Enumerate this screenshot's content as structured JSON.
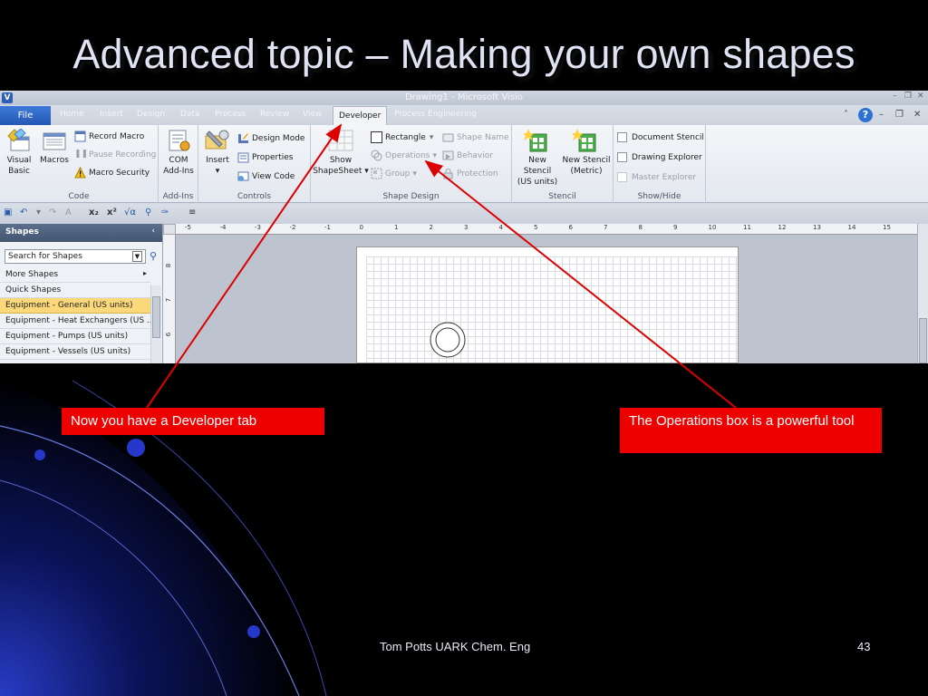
{
  "slide": {
    "title": "Advanced topic – Making your own shapes",
    "footer_author": "Tom Potts  UARK Chem. Eng",
    "page_number": "43"
  },
  "window": {
    "title": "Drawing1 - Microsoft Visio",
    "app_icon_letter": "V"
  },
  "tabs": {
    "file": "File",
    "items": [
      "Home",
      "Insert",
      "Design",
      "Data",
      "Process",
      "Review",
      "View",
      "Developer",
      "Process Engineering"
    ],
    "active": "Developer"
  },
  "ribbon": {
    "code": {
      "label": "Code",
      "visual_basic": "Visual\nBasic",
      "visual_basic_l1": "Visual",
      "visual_basic_l2": "Basic",
      "macros": "Macros",
      "record_macro": "Record Macro",
      "pause_recording": "Pause Recording",
      "macro_security": "Macro Security"
    },
    "addins": {
      "label": "Add-Ins",
      "com_l1": "COM",
      "com_l2": "Add-Ins"
    },
    "controls": {
      "label": "Controls",
      "insert": "Insert",
      "design_mode": "Design Mode",
      "properties": "Properties",
      "view_code": "View Code"
    },
    "shape_design": {
      "label": "Shape Design",
      "show_l1": "Show",
      "show_l2": "ShapeSheet",
      "rectangle": "Rectangle",
      "operations": "Operations",
      "group": "Group",
      "shape_name": "Shape Name",
      "behavior": "Behavior",
      "protection": "Protection"
    },
    "stencil": {
      "label": "Stencil",
      "new_us_l1": "New Stencil",
      "new_us_l2": "(US units)",
      "new_metric_l1": "New Stencil",
      "new_metric_l2": "(Metric)"
    },
    "show_hide": {
      "label": "Show/Hide",
      "document_stencil": "Document Stencil",
      "drawing_explorer": "Drawing Explorer",
      "master_explorer": "Master Explorer"
    }
  },
  "shapes_panel": {
    "header": "Shapes",
    "search_value": "Search for Shapes",
    "more_shapes": "More Shapes",
    "items": [
      "Quick Shapes",
      "Equipment - General (US units)",
      "Equipment - Heat Exchangers (US ...",
      "Equipment - Pumps (US units)",
      "Equipment - Vessels (US units)"
    ],
    "selected_index": 1
  },
  "ruler": {
    "top_ticks": [
      "-5",
      "-4",
      "-3",
      "-2",
      "-1",
      "0",
      "1",
      "2",
      "3",
      "4",
      "5",
      "6",
      "7",
      "8",
      "9",
      "10",
      "11",
      "12",
      "13",
      "14",
      "15"
    ],
    "left_ticks": [
      "8",
      "7",
      "6"
    ]
  },
  "callouts": {
    "developer": "Now you have a Developer tab",
    "operations": "The Operations box is a powerful tool"
  },
  "colors": {
    "callout": "#ee0000",
    "pointer": "#dd0000",
    "file_tab": "#2f66c2",
    "selected_row": "#fbd87a"
  }
}
